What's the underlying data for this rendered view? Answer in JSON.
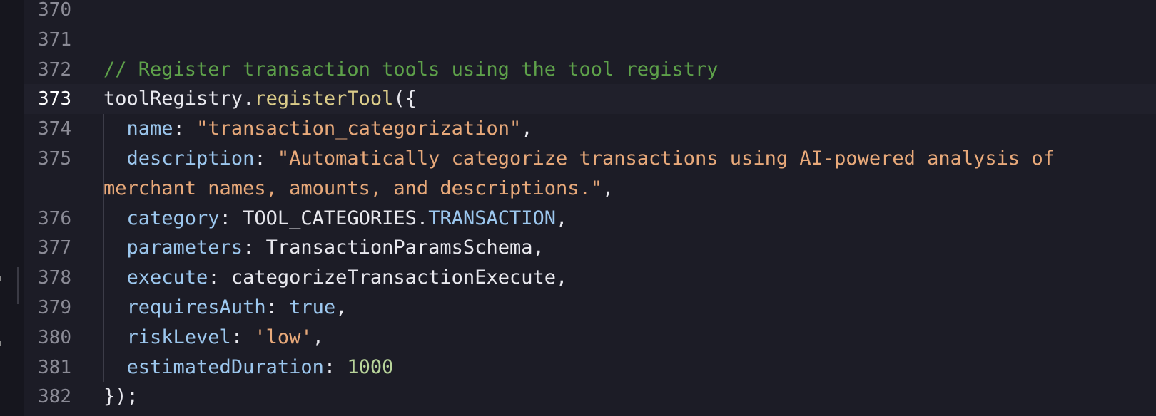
{
  "editor": {
    "current_line": "373",
    "lines": [
      {
        "number": "370",
        "tokens": []
      },
      {
        "number": "371",
        "tokens": []
      },
      {
        "number": "372",
        "tokens": [
          {
            "t": "// Register transaction tools using the tool registry",
            "k": "comment"
          }
        ]
      },
      {
        "number": "373",
        "tokens": [
          {
            "t": "toolRegistry",
            "k": "text"
          },
          {
            "t": ".",
            "k": "punct"
          },
          {
            "t": "registerTool",
            "k": "method"
          },
          {
            "t": "({",
            "k": "punct"
          }
        ]
      },
      {
        "number": "374",
        "tokens": [
          {
            "t": "  ",
            "k": "text"
          },
          {
            "t": "name",
            "k": "prop"
          },
          {
            "t": ": ",
            "k": "punct"
          },
          {
            "t": "\"transaction_categorization\"",
            "k": "string"
          },
          {
            "t": ",",
            "k": "punct"
          }
        ]
      },
      {
        "number": "375",
        "tokens": [
          {
            "t": "  ",
            "k": "text"
          },
          {
            "t": "description",
            "k": "prop"
          },
          {
            "t": ": ",
            "k": "punct"
          },
          {
            "t": "\"Automatically categorize transactions using AI-powered analysis of",
            "k": "string"
          }
        ]
      },
      {
        "number": "",
        "tokens": [
          {
            "t": "merchant names, amounts, and descriptions.\"",
            "k": "string"
          },
          {
            "t": ",",
            "k": "punct"
          }
        ]
      },
      {
        "number": "376",
        "tokens": [
          {
            "t": "  ",
            "k": "text"
          },
          {
            "t": "category",
            "k": "prop"
          },
          {
            "t": ": ",
            "k": "punct"
          },
          {
            "t": "TOOL_CATEGORIES",
            "k": "const"
          },
          {
            "t": ".",
            "k": "punct"
          },
          {
            "t": "TRANSACTION",
            "k": "prop"
          },
          {
            "t": ",",
            "k": "punct"
          }
        ]
      },
      {
        "number": "377",
        "tokens": [
          {
            "t": "  ",
            "k": "text"
          },
          {
            "t": "parameters",
            "k": "prop"
          },
          {
            "t": ": ",
            "k": "punct"
          },
          {
            "t": "TransactionParamsSchema",
            "k": "text"
          },
          {
            "t": ",",
            "k": "punct"
          }
        ]
      },
      {
        "number": "378",
        "tokens": [
          {
            "t": "  ",
            "k": "text"
          },
          {
            "t": "execute",
            "k": "prop"
          },
          {
            "t": ": ",
            "k": "punct"
          },
          {
            "t": "categorizeTransactionExecute",
            "k": "text"
          },
          {
            "t": ",",
            "k": "punct"
          }
        ]
      },
      {
        "number": "379",
        "tokens": [
          {
            "t": "  ",
            "k": "text"
          },
          {
            "t": "requiresAuth",
            "k": "prop"
          },
          {
            "t": ": ",
            "k": "punct"
          },
          {
            "t": "true",
            "k": "bool"
          },
          {
            "t": ",",
            "k": "punct"
          }
        ]
      },
      {
        "number": "380",
        "tokens": [
          {
            "t": "  ",
            "k": "text"
          },
          {
            "t": "riskLevel",
            "k": "prop"
          },
          {
            "t": ": ",
            "k": "punct"
          },
          {
            "t": "'low'",
            "k": "string"
          },
          {
            "t": ",",
            "k": "punct"
          }
        ]
      },
      {
        "number": "381",
        "tokens": [
          {
            "t": "  ",
            "k": "text"
          },
          {
            "t": "estimatedDuration",
            "k": "prop"
          },
          {
            "t": ": ",
            "k": "punct"
          },
          {
            "t": "1000",
            "k": "number"
          }
        ]
      },
      {
        "number": "382",
        "tokens": [
          {
            "t": "});",
            "k": "punct"
          }
        ]
      }
    ]
  },
  "colors": {
    "background": "#1c1c26",
    "comment": "#5ea14a",
    "string": "#e8a97a",
    "property": "#9cc7ee",
    "method": "#dccd8a",
    "number": "#b8d49a"
  }
}
